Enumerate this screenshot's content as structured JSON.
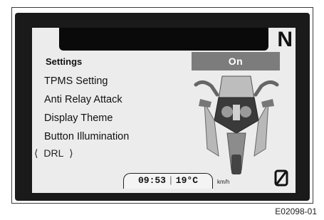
{
  "display": {
    "gear_indicator": "N",
    "settings_title": "Settings",
    "selected_value": "On",
    "menu_items": [
      "TPMS Setting",
      "Anti Relay Attack",
      "Display Theme",
      "Button Illumination"
    ],
    "nav": {
      "left_arrow": "⟨",
      "current": "DRL",
      "right_arrow": "⟩"
    },
    "status": {
      "time": "09:53",
      "separator": "|",
      "temperature": "19°C",
      "speed_unit": "km/h",
      "box_symbol": "0"
    },
    "icons": {
      "motorcycle": "motorcycle-front-icon"
    }
  },
  "figure_id": "E02098-01"
}
